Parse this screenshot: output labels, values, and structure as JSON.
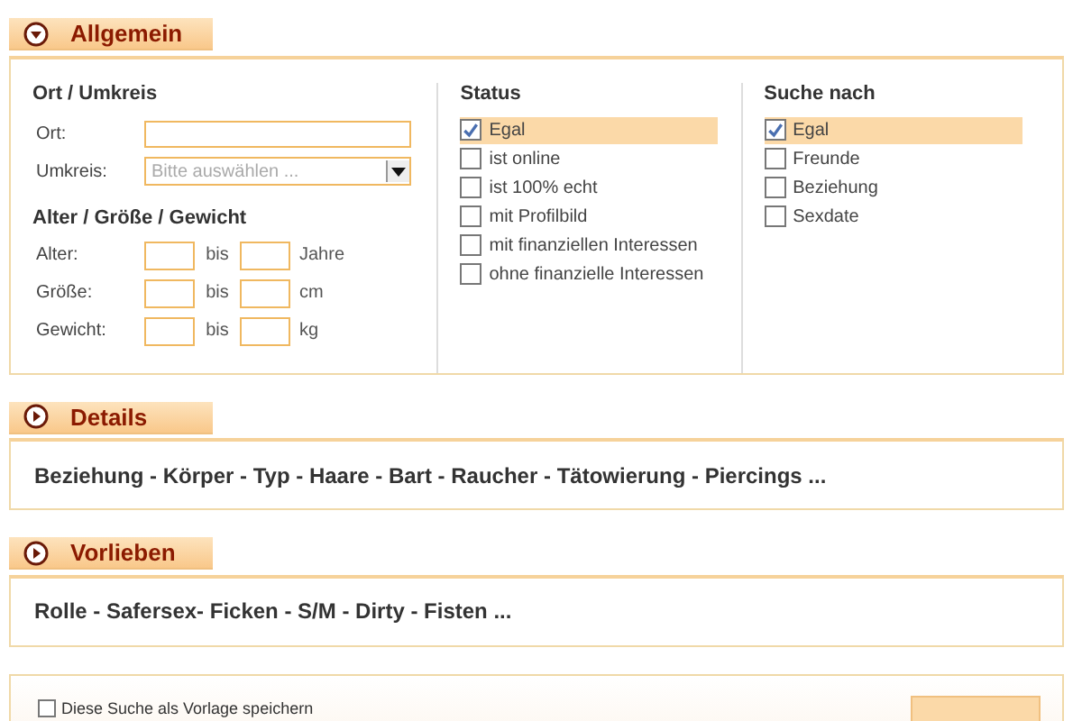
{
  "sections": [
    {
      "kind": "form",
      "title": "Allgemein",
      "expanded": true,
      "location": {
        "heading": "Ort / Umkreis",
        "ort_label": "Ort:",
        "umkreis_label": "Umkreis:",
        "umkreis_placeholder": "Bitte auswählen ..."
      },
      "measures": {
        "heading": "Alter / Größe / Gewicht",
        "rows": [
          {
            "label": "Alter:",
            "between": "bis",
            "unit": "Jahre"
          },
          {
            "label": "Größe:",
            "between": "bis",
            "unit": "cm"
          },
          {
            "label": "Gewicht:",
            "between": "bis",
            "unit": "kg"
          }
        ]
      },
      "groups": [
        {
          "heading": "Status",
          "options": [
            {
              "label": "Egal",
              "checked": true
            },
            {
              "label": "ist online",
              "checked": false
            },
            {
              "label": "ist 100% echt",
              "checked": false
            },
            {
              "label": "mit Profilbild",
              "checked": false
            },
            {
              "label": "mit finanziellen Interessen",
              "checked": false
            },
            {
              "label": "ohne finanzielle Interessen",
              "checked": false
            }
          ]
        },
        {
          "heading": "Suche nach",
          "options": [
            {
              "label": "Egal",
              "checked": true
            },
            {
              "label": "Freunde",
              "checked": false
            },
            {
              "label": "Beziehung",
              "checked": false
            },
            {
              "label": "Sexdate",
              "checked": false
            }
          ]
        }
      ]
    },
    {
      "kind": "links",
      "title": "Details",
      "expanded": false,
      "text": "Beziehung - Körper - Typ - Haare - Bart - Raucher - Tätowierung - Piercings ..."
    },
    {
      "kind": "links",
      "title": "Vorlieben",
      "expanded": false,
      "text": "Rolle - Safersex- Ficken - S/M - Dirty - Fisten ..."
    }
  ],
  "footer": {
    "save_template": {
      "label": "Diese Suche als Vorlage speichern",
      "checked": false
    }
  }
}
